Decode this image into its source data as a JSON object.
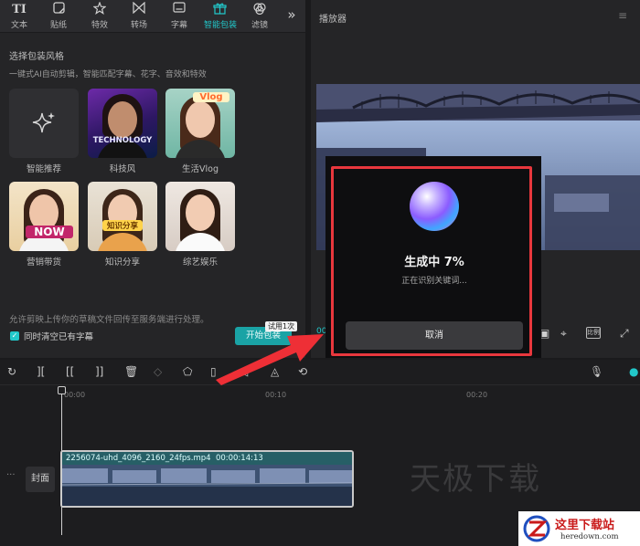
{
  "toolbar": {
    "tools": [
      {
        "label": "文本",
        "icon": "TI"
      },
      {
        "label": "贴纸",
        "icon": "sticker-icon"
      },
      {
        "label": "特效",
        "icon": "effects-icon"
      },
      {
        "label": "转场",
        "icon": "transition-icon"
      },
      {
        "label": "字幕",
        "icon": "subtitle-icon"
      },
      {
        "label": "智能包装",
        "icon": "smart-pack-icon",
        "active": true
      },
      {
        "label": "滤镜",
        "icon": "filter-icon"
      }
    ],
    "more": "»"
  },
  "panel": {
    "section_title": "选择包装风格",
    "section_subtitle": "一键式AI自动剪辑，智能匹配字幕、花字、音效和特效",
    "styles": [
      {
        "label": "智能推荐"
      },
      {
        "label": "科技风",
        "banner": "TECHNOLOGY"
      },
      {
        "label": "生活Vlog",
        "banner": "Vlog"
      },
      {
        "label": "营销带货",
        "banner": "NOW"
      },
      {
        "label": "知识分享",
        "banner": "知识分享"
      },
      {
        "label": "综艺娱乐"
      }
    ],
    "footer_note": "允许剪映上传你的草稿文件回传至服务端进行处理。",
    "clear_checkbox_label": "同时清空已有字幕",
    "clear_checked": true,
    "start_button": "开始包装",
    "trial_tag": "试用1次"
  },
  "player": {
    "title": "播放器",
    "timecode": "00",
    "ratio_label": "比例"
  },
  "modal": {
    "title": "生成中 7%",
    "progress_percent": 7,
    "subtitle": "正在识别关键词...",
    "cancel": "取消"
  },
  "timeline": {
    "ruler": [
      "00:00",
      "00:10",
      "00:20"
    ],
    "cover_button": "封面",
    "clip_label": "2256074-uhd_4096_2160_24fps.mp4",
    "clip_duration": "00:00:14:13",
    "watermark": "天极下载"
  },
  "logo": {
    "name": "这里下载站",
    "url": "heredown.com"
  },
  "colors": {
    "accent": "#22c7c9",
    "modal_border": "#e8373d"
  }
}
